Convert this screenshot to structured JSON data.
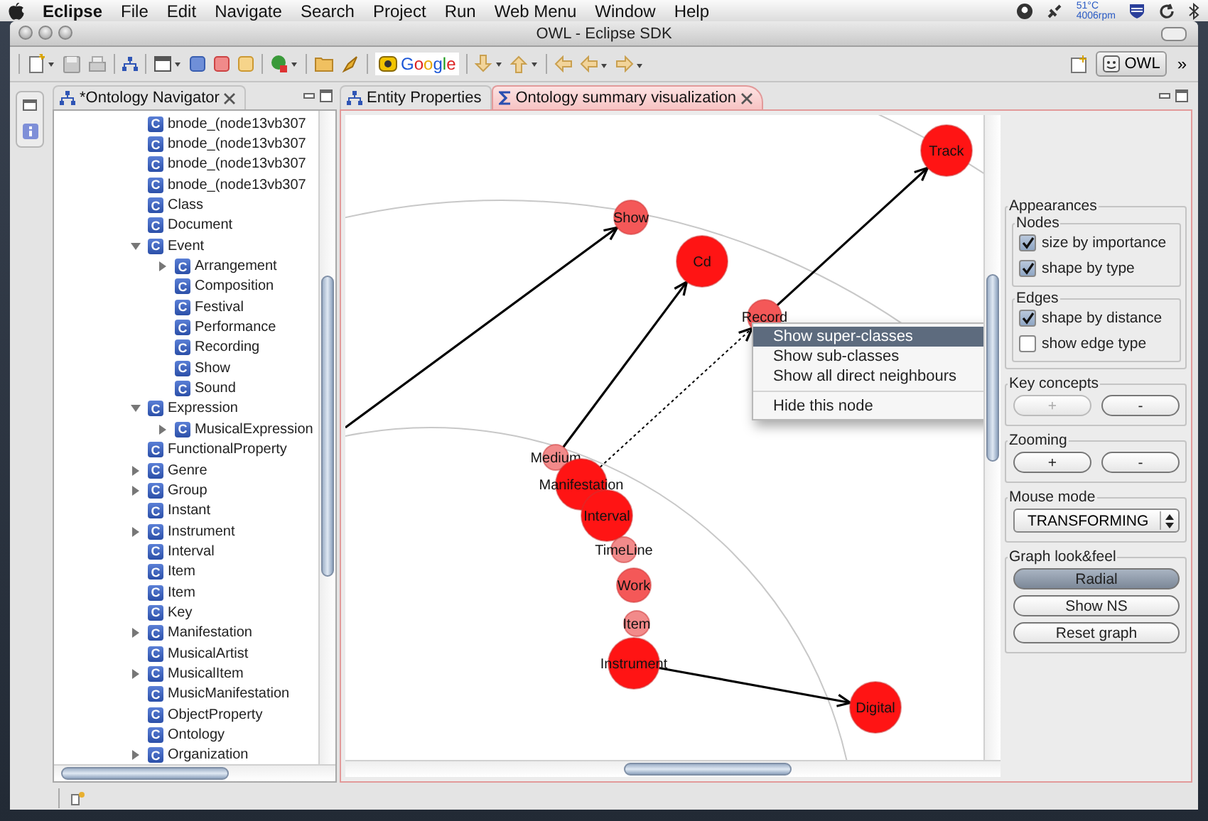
{
  "menubar": {
    "app": "Eclipse",
    "menus": [
      "File",
      "Edit",
      "Navigate",
      "Search",
      "Project",
      "Run",
      "Web Menu",
      "Window",
      "Help"
    ],
    "temperature": "51°C",
    "fan_speed": "4006rpm"
  },
  "window": {
    "title": "OWL - Eclipse SDK"
  },
  "toolbar": {
    "search_engine": "Google",
    "perspective": "OWL",
    "overflow": "»"
  },
  "navigator": {
    "tab": "*Ontology Navigator",
    "tree": [
      {
        "label": "bnode_(node13vb307",
        "icon": "C"
      },
      {
        "label": "bnode_(node13vb307",
        "icon": "C"
      },
      {
        "label": "bnode_(node13vb307",
        "icon": "C"
      },
      {
        "label": "bnode_(node13vb307",
        "icon": "C"
      },
      {
        "label": "Class",
        "icon": "C"
      },
      {
        "label": "Document",
        "icon": "C"
      },
      {
        "label": "Event",
        "icon": "C",
        "expanded": true,
        "children": [
          {
            "label": "Arrangement",
            "icon": "C",
            "expanded": false
          },
          {
            "label": "Composition",
            "icon": "C"
          },
          {
            "label": "Festival",
            "icon": "C"
          },
          {
            "label": "Performance",
            "icon": "C"
          },
          {
            "label": "Recording",
            "icon": "C"
          },
          {
            "label": "Show",
            "icon": "C"
          },
          {
            "label": "Sound",
            "icon": "C"
          }
        ]
      },
      {
        "label": "Expression",
        "icon": "C",
        "expanded": true,
        "children": [
          {
            "label": "MusicalExpression",
            "icon": "C",
            "expanded": false
          }
        ]
      },
      {
        "label": "FunctionalProperty",
        "icon": "C"
      },
      {
        "label": "Genre",
        "icon": "C",
        "expanded": false
      },
      {
        "label": "Group",
        "icon": "C",
        "expanded": false
      },
      {
        "label": "Instant",
        "icon": "C"
      },
      {
        "label": "Instrument",
        "icon": "C",
        "expanded": false
      },
      {
        "label": "Interval",
        "icon": "C"
      },
      {
        "label": "Item",
        "icon": "C"
      },
      {
        "label": "Item",
        "icon": "C"
      },
      {
        "label": "Key",
        "icon": "C"
      },
      {
        "label": "Manifestation",
        "icon": "C",
        "expanded": false
      },
      {
        "label": "MusicalArtist",
        "icon": "C"
      },
      {
        "label": "MusicalItem",
        "icon": "C",
        "expanded": false
      },
      {
        "label": "MusicManifestation",
        "icon": "C"
      },
      {
        "label": "ObjectProperty",
        "icon": "C"
      },
      {
        "label": "Ontology",
        "icon": "C"
      },
      {
        "label": "Organization",
        "icon": "C",
        "expanded": false
      }
    ]
  },
  "editor": {
    "tabs": [
      {
        "label": "Entity Properties",
        "selected": false
      },
      {
        "label": "Ontology summary visualization",
        "selected": true
      }
    ],
    "graph": {
      "nodes": [
        {
          "label": "Track",
          "kind": "major"
        },
        {
          "label": "Show",
          "kind": "mid"
        },
        {
          "label": "Cd",
          "kind": "major"
        },
        {
          "label": "Record",
          "kind": "mid"
        },
        {
          "label": "Medium",
          "kind": "minor"
        },
        {
          "label": "Manifestation",
          "kind": "major"
        },
        {
          "label": "Interval",
          "kind": "major"
        },
        {
          "label": "TimeLine",
          "kind": "minor"
        },
        {
          "label": "Work",
          "kind": "mid"
        },
        {
          "label": "Item",
          "kind": "minor"
        },
        {
          "label": "Instrument",
          "kind": "major"
        },
        {
          "label": "Digital",
          "kind": "major"
        }
      ],
      "edges": [
        {
          "kind": "direct"
        },
        {
          "kind": "direct"
        },
        {
          "kind": "inferred"
        },
        {
          "kind": "direct"
        },
        {
          "kind": "direct"
        }
      ]
    },
    "context_menu": {
      "groups": [
        [
          {
            "label": "Show super-classes",
            "selected": true
          },
          {
            "label": "Show sub-classes",
            "selected": false
          },
          {
            "label": "Show all direct neighbours",
            "selected": false
          }
        ],
        [
          {
            "label": "Hide this node",
            "selected": false
          }
        ]
      ]
    }
  },
  "controls": {
    "title": "Appearances",
    "nodes": {
      "title": "Nodes",
      "options": [
        {
          "label": "size by importance",
          "checked": true
        },
        {
          "label": "shape by type",
          "checked": true
        }
      ]
    },
    "edges": {
      "title": "Edges",
      "options": [
        {
          "label": "shape by distance",
          "checked": true
        },
        {
          "label": "show edge type",
          "checked": false
        }
      ]
    },
    "key_concepts": {
      "title": "Key concepts",
      "buttons": [
        {
          "label": "+",
          "disabled": true
        },
        {
          "label": "-",
          "disabled": false
        }
      ]
    },
    "zooming": {
      "title": "Zooming",
      "buttons": [
        {
          "label": "+",
          "disabled": false
        },
        {
          "label": "-",
          "disabled": false
        }
      ]
    },
    "mouse_mode": {
      "title": "Mouse mode",
      "value": "TRANSFORMING"
    },
    "look_and_feel": {
      "title": "Graph look&feel",
      "buttons": [
        {
          "label": "Radial",
          "selected": true
        },
        {
          "label": "Show NS",
          "selected": false
        },
        {
          "label": "Reset graph",
          "selected": false
        }
      ]
    }
  }
}
